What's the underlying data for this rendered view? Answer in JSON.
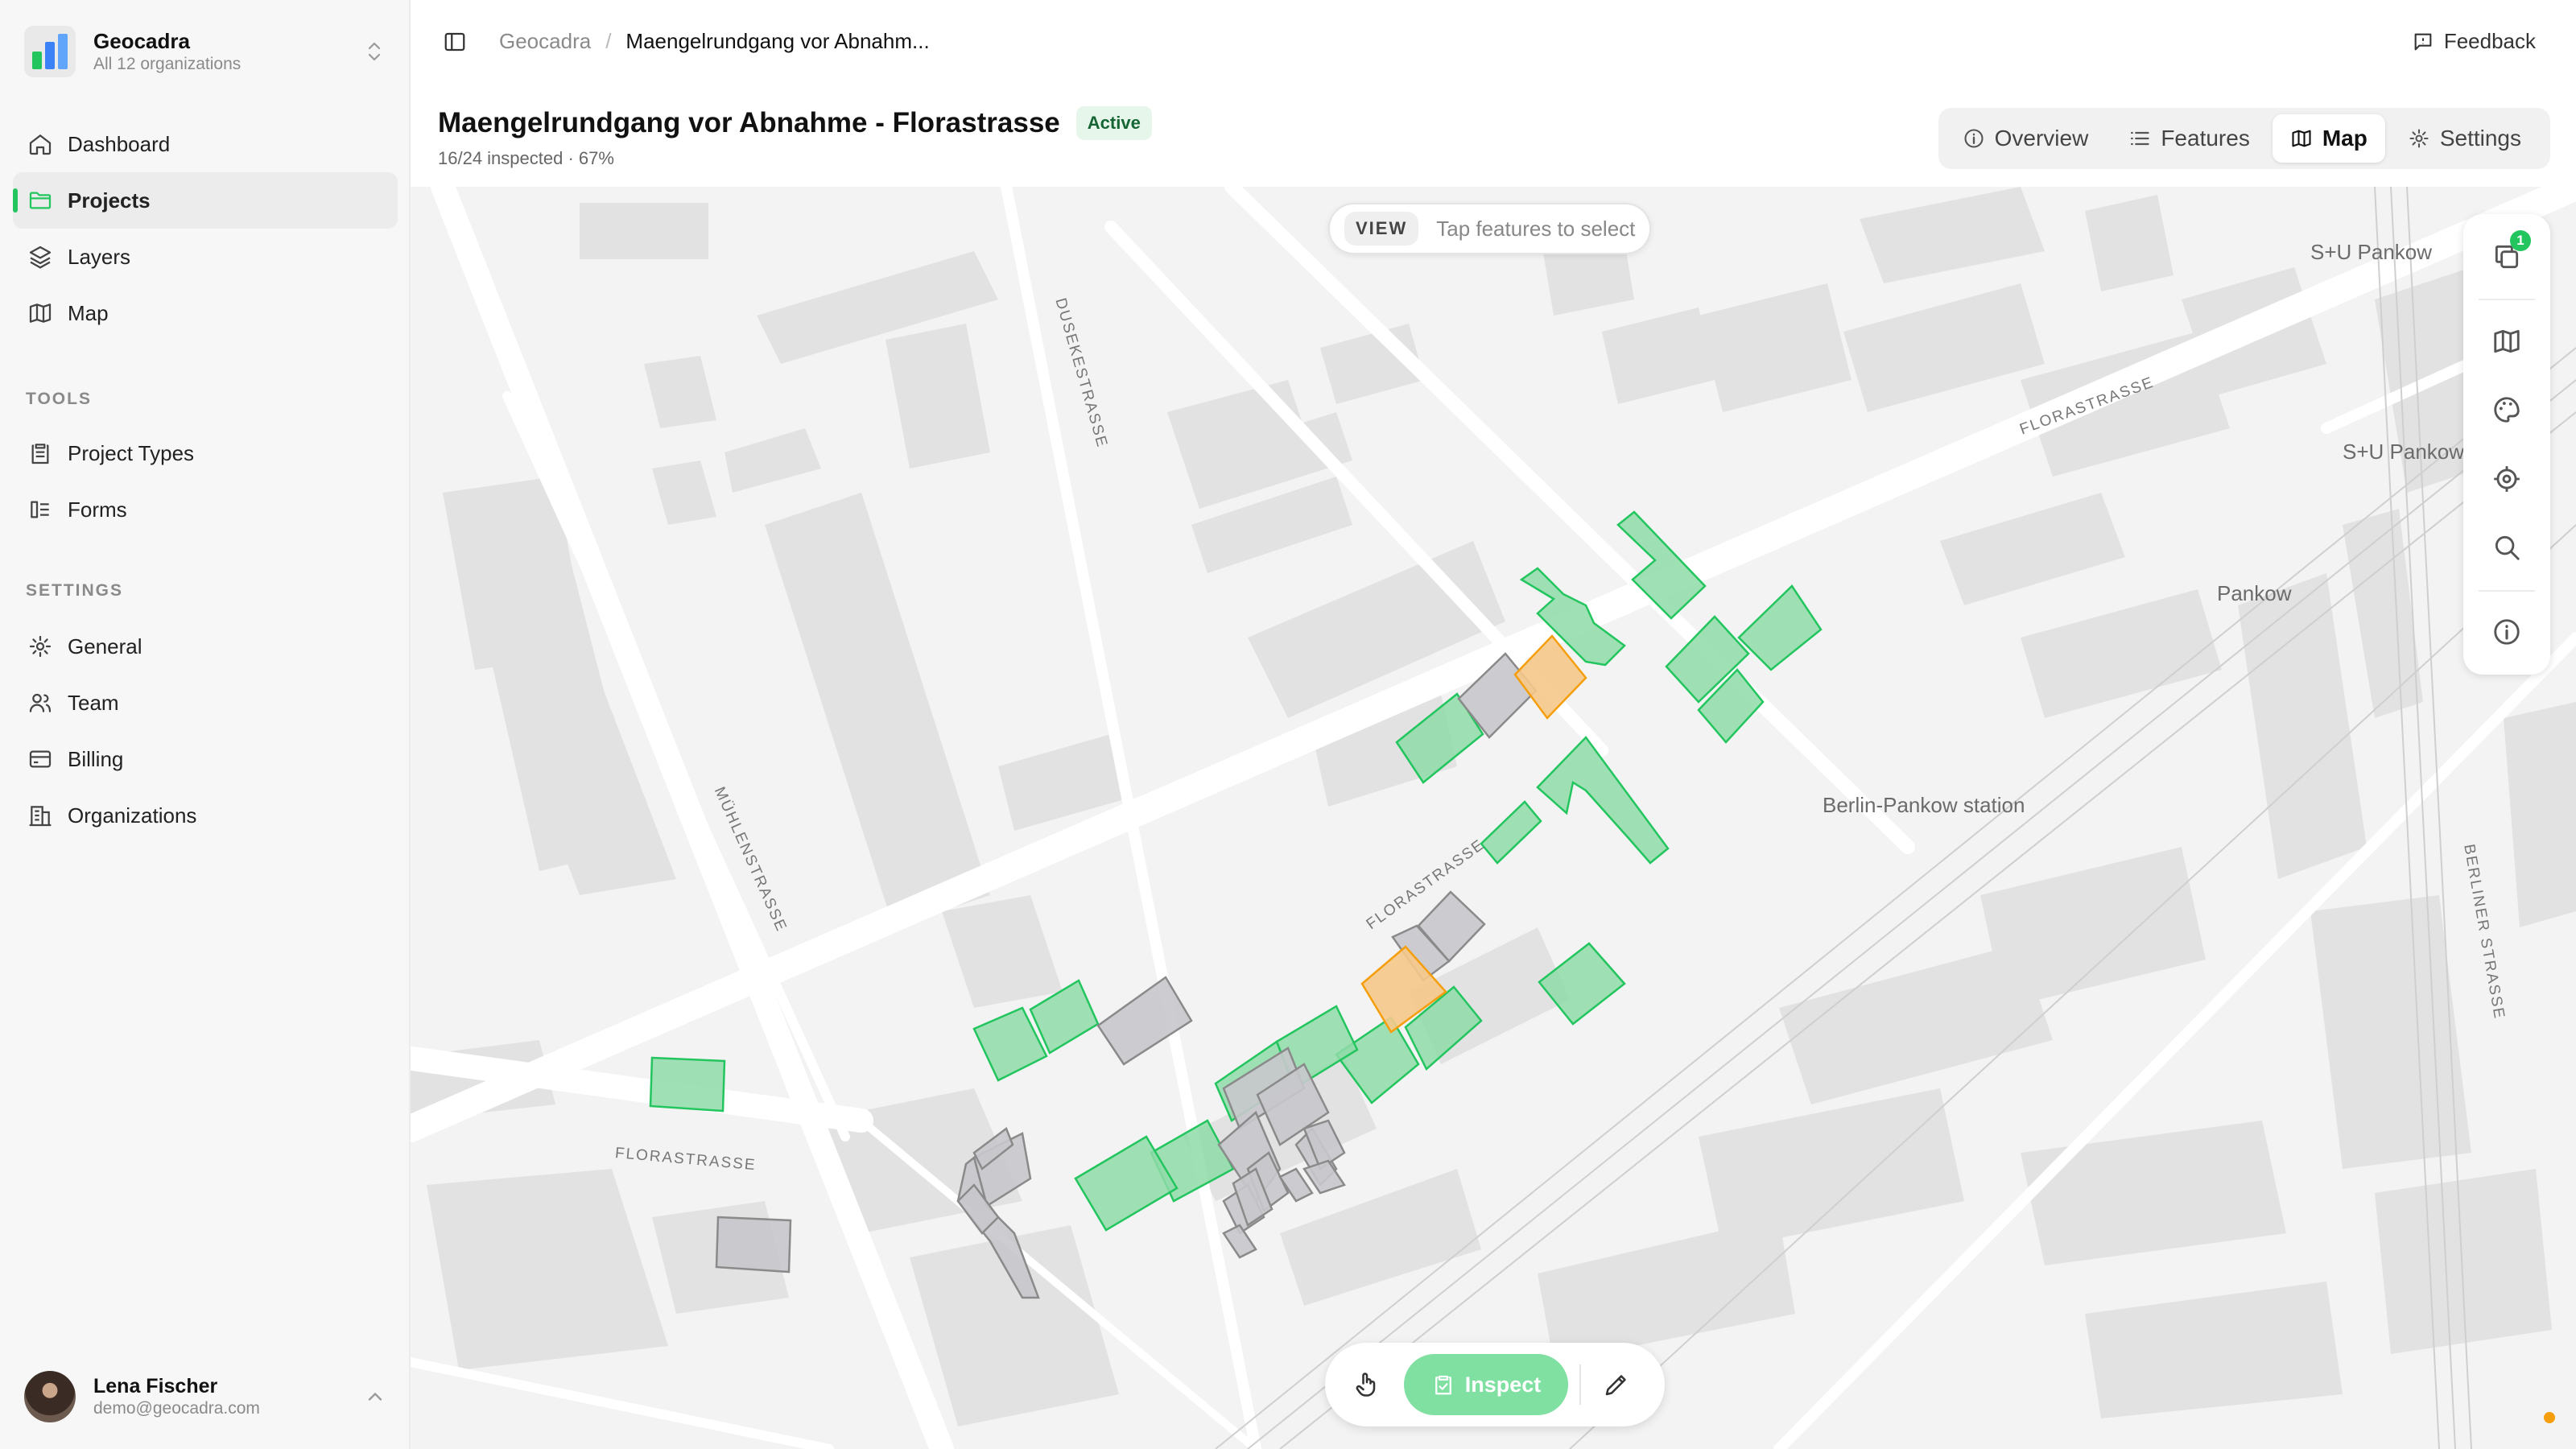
{
  "org": {
    "name": "Geocadra",
    "subtitle": "All 12 organizations"
  },
  "nav": {
    "main": [
      {
        "label": "Dashboard",
        "icon": "home-icon"
      },
      {
        "label": "Projects",
        "icon": "folder-icon",
        "active": true
      },
      {
        "label": "Layers",
        "icon": "layers-icon"
      },
      {
        "label": "Map",
        "icon": "map-icon"
      }
    ],
    "tools_label": "TOOLS",
    "tools": [
      {
        "label": "Project Types",
        "icon": "clipboard-icon"
      },
      {
        "label": "Forms",
        "icon": "form-icon"
      }
    ],
    "settings_label": "SETTINGS",
    "settings": [
      {
        "label": "General",
        "icon": "gear-icon"
      },
      {
        "label": "Team",
        "icon": "users-icon"
      },
      {
        "label": "Billing",
        "icon": "card-icon"
      },
      {
        "label": "Organizations",
        "icon": "building-icon"
      }
    ]
  },
  "user": {
    "name": "Lena Fischer",
    "email": "demo@geocadra.com"
  },
  "breadcrumb": {
    "root": "Geocadra",
    "current": "Maengelrundgang vor Abnahm..."
  },
  "feedback_label": "Feedback",
  "project": {
    "title": "Maengelrundgang vor Abnahme - Florastrasse",
    "status": "Active",
    "progress_text": "16/24 inspected · 67%"
  },
  "tabs": [
    {
      "label": "Overview",
      "icon": "info-icon"
    },
    {
      "label": "Features",
      "icon": "list-icon"
    },
    {
      "label": "Map",
      "icon": "map-icon",
      "active": true
    },
    {
      "label": "Settings",
      "icon": "gear-icon"
    }
  ],
  "map": {
    "mode_tag": "VIEW",
    "mode_hint": "Tap features to select",
    "layer_count": "1",
    "labels": {
      "station": "Berlin-Pankow station",
      "su_pankow_1": "S+U Pankow",
      "su_pankow_2": "S+U Pankow",
      "pankow": "Pankow",
      "florastrasse_1": "FLORASTRASSE",
      "florastrasse_2": "FLORASTRASSE",
      "florastrasse_3": "FLORASTRASSE",
      "dusekestrasse": "DUSEKESTRASSE",
      "muhlenstrasse": "MÜHLENSTRASSE",
      "berliner_strasse": "BERLINER STRASSE"
    },
    "colors": {
      "inspected": "#22c55e",
      "pending": "#9ca3af",
      "issue": "#f59e0b"
    }
  },
  "bottom_tools": {
    "inspect_label": "Inspect"
  }
}
